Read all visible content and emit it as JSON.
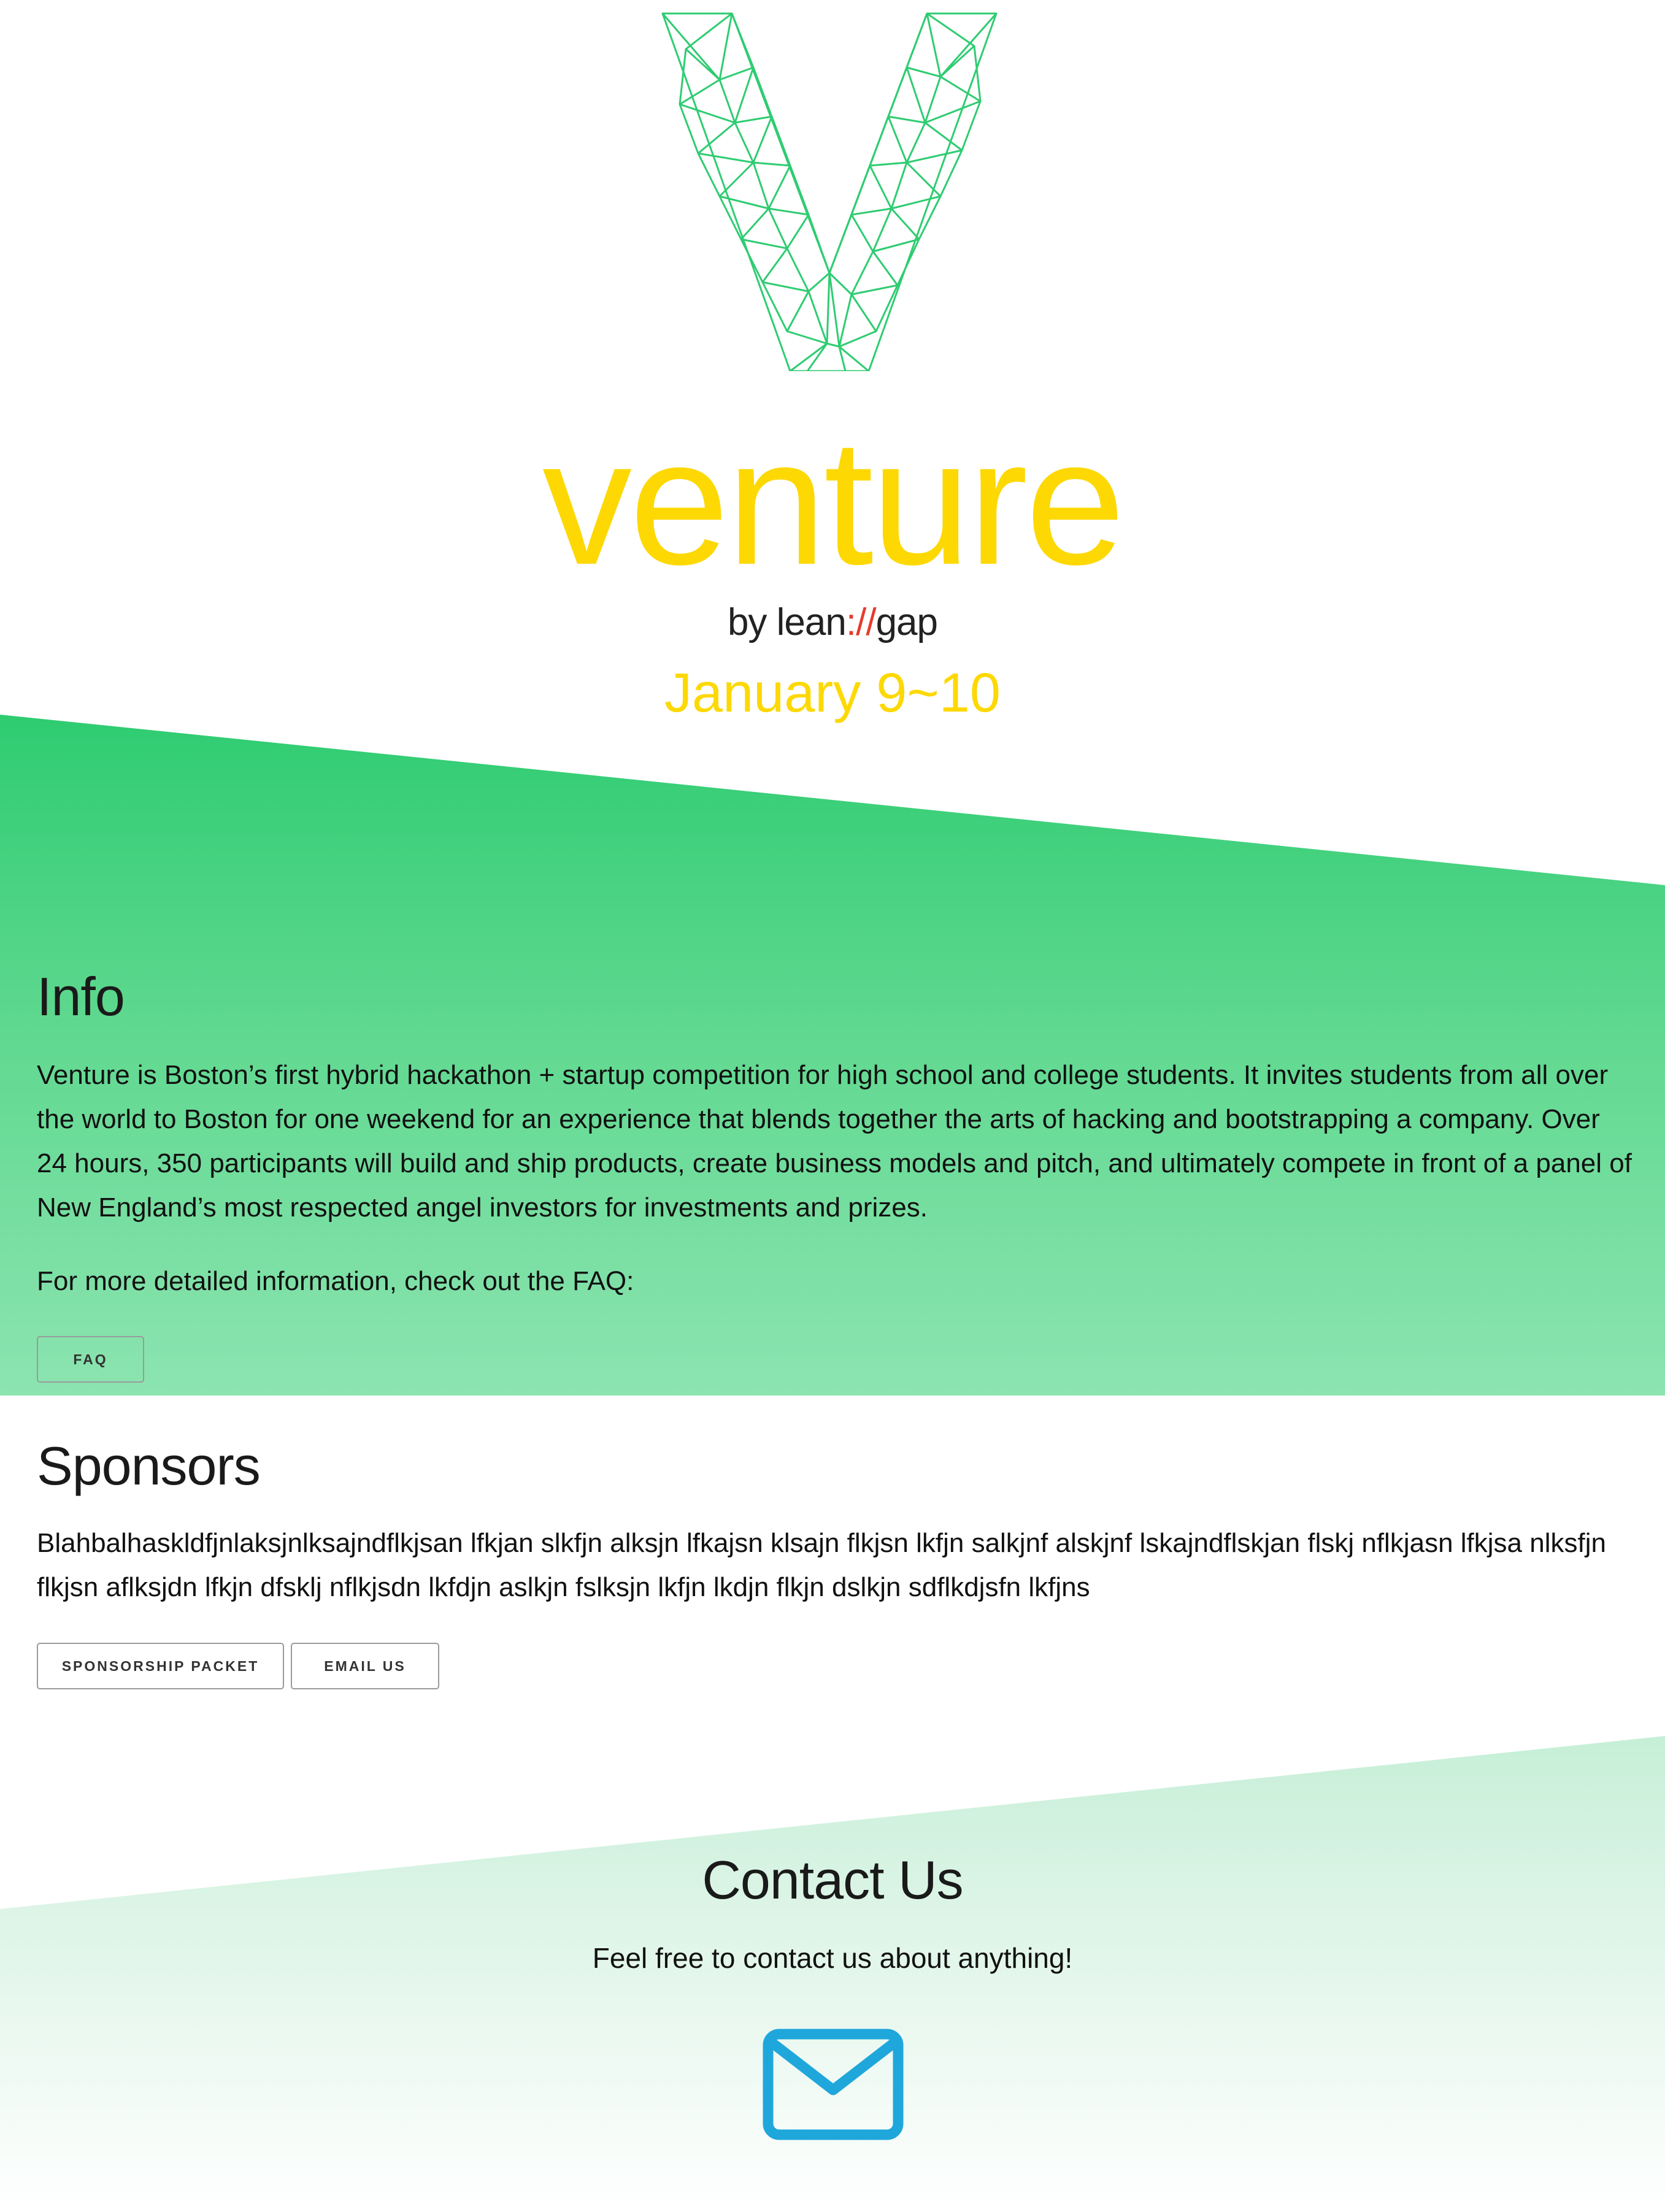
{
  "brand": {
    "logo_icon": "triangulated-v-logo",
    "wordmark": "venture",
    "byline_prefix": "by lean",
    "byline_slashes": "://",
    "byline_suffix": "gap",
    "date": "January 9~10",
    "colors": {
      "wordmark": "#fdd803",
      "logo_stroke": "#2ecc71",
      "slashes": "#e63b2e"
    }
  },
  "info": {
    "title": "Info",
    "paragraph": "Venture is Boston’s first hybrid hackathon + startup competition for high school and college students. It invites students from all over the world to Boston for one weekend for an experience that blends together the arts of hacking and bootstrapping a company. Over 24 hours, 350 participants will build and ship products, create business models and pitch, and ultimately compete in front of a panel of New England’s most respected angel investors for investments and prizes.",
    "faq_prompt": "For more detailed information, check out the FAQ:",
    "faq_button": "FAQ",
    "band_color": "#2ecc71"
  },
  "sponsors": {
    "title": "Sponsors",
    "paragraph": "Blahbalhaskldfjnlaksjnlksajndflkjsan lfkjan slkfjn alksjn lfkajsn klsajn flkjsn lkfjn salkjnf alskjnf lskajndflskjan flskj nflkjasn lfkjsa nlksfjn flkjsn aflksjdn lfkjn dfsklj nflkjsdn lkfdjn aslkjn fslksjn lkfjn lkdjn flkjn dslkjn sdflkdjsfn lkfjns",
    "packet_button": "SPONSORSHIP PACKET",
    "email_button": "EMAIL US"
  },
  "contact": {
    "title": "Contact Us",
    "text": "Feel free to contact us about anything!",
    "icon": "mail-icon",
    "icon_color": "#1fa7dc"
  }
}
